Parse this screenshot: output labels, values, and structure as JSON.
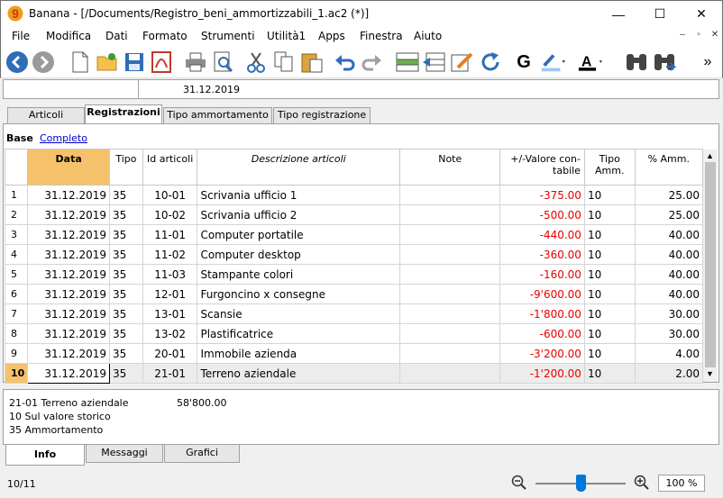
{
  "window": {
    "title": "Banana - [/Documents/Registro_beni_ammortizzabili_1.ac2 (*)]",
    "minimize": "—",
    "maximize": "☐",
    "close": "✕"
  },
  "menu": [
    "File",
    "Modifica",
    "Dati",
    "Formato",
    "Strumenti",
    "Utilità1",
    "Apps",
    "Finestra",
    "Aiuto"
  ],
  "mdi_controls": [
    "–",
    "▫",
    "✕"
  ],
  "toolbar": {
    "bold_label": "G",
    "more_label": "»",
    "icons": [
      "back-icon",
      "forward-icon",
      "new-file-icon",
      "open-folder-icon",
      "save-icon",
      "pdf-icon",
      "print-icon",
      "print-preview-icon",
      "cut-icon",
      "copy-icon",
      "paste-icon",
      "undo-icon",
      "redo-icon",
      "insert-row-icon",
      "delete-row-icon",
      "edit-pencil-icon",
      "refresh-icon",
      "bold-icon",
      "highlight-icon",
      "font-color-icon",
      "find-icon",
      "find-next-icon"
    ]
  },
  "cellbar": {
    "value": "31.12.2019"
  },
  "tabs": [
    "Articoli",
    "Registrazioni",
    "Tipo ammortamento",
    "Tipo registrazione"
  ],
  "active_tab": "Registrazioni",
  "views": {
    "base": "Base",
    "completo": "Completo"
  },
  "table": {
    "columns": [
      "Data",
      "Tipo",
      "Id articoli",
      "Descrizione articoli",
      "Note",
      "+/-Valore con-\ntabile",
      "Tipo\nAmm.",
      "% Amm."
    ],
    "rows": [
      {
        "n": "1",
        "data": "31.12.2019",
        "tipo": "35",
        "id": "10-01",
        "desc": "Scrivania ufficio 1",
        "note": "",
        "valore": "-375.00",
        "tipo_amm": "10",
        "perc": "25.00"
      },
      {
        "n": "2",
        "data": "31.12.2019",
        "tipo": "35",
        "id": "10-02",
        "desc": "Scrivania ufficio 2",
        "note": "",
        "valore": "-500.00",
        "tipo_amm": "10",
        "perc": "25.00"
      },
      {
        "n": "3",
        "data": "31.12.2019",
        "tipo": "35",
        "id": "11-01",
        "desc": "Computer portatile",
        "note": "",
        "valore": "-440.00",
        "tipo_amm": "10",
        "perc": "40.00"
      },
      {
        "n": "4",
        "data": "31.12.2019",
        "tipo": "35",
        "id": "11-02",
        "desc": "Computer desktop",
        "note": "",
        "valore": "-360.00",
        "tipo_amm": "10",
        "perc": "40.00"
      },
      {
        "n": "5",
        "data": "31.12.2019",
        "tipo": "35",
        "id": "11-03",
        "desc": "Stampante colori",
        "note": "",
        "valore": "-160.00",
        "tipo_amm": "10",
        "perc": "40.00"
      },
      {
        "n": "6",
        "data": "31.12.2019",
        "tipo": "35",
        "id": "12-01",
        "desc": "Furgoncino x consegne",
        "note": "",
        "valore": "-9'600.00",
        "tipo_amm": "10",
        "perc": "40.00"
      },
      {
        "n": "7",
        "data": "31.12.2019",
        "tipo": "35",
        "id": "13-01",
        "desc": "Scansie",
        "note": "",
        "valore": "-1'800.00",
        "tipo_amm": "10",
        "perc": "30.00"
      },
      {
        "n": "8",
        "data": "31.12.2019",
        "tipo": "35",
        "id": "13-02",
        "desc": "Plastificatrice",
        "note": "",
        "valore": "-600.00",
        "tipo_amm": "10",
        "perc": "30.00"
      },
      {
        "n": "9",
        "data": "31.12.2019",
        "tipo": "35",
        "id": "20-01",
        "desc": "Immobile azienda",
        "note": "",
        "valore": "-3'200.00",
        "tipo_amm": "10",
        "perc": "4.00"
      },
      {
        "n": "10",
        "data": "31.12.2019",
        "tipo": "35",
        "id": "21-01",
        "desc": "Terreno aziendale",
        "note": "",
        "valore": "-1'200.00",
        "tipo_amm": "10",
        "perc": "2.00"
      }
    ]
  },
  "info": {
    "line1_label": "21-01 Terreno aziendale",
    "line1_value": "58'800.00",
    "line2": "10 Sul valore storico",
    "line3": "35 Ammortamento"
  },
  "bottom_tabs": [
    "Info",
    "Messaggi",
    "Grafici"
  ],
  "status": {
    "position": "10/11",
    "zoom": "100 %",
    "zoom_level_percent": 100
  },
  "colors": {
    "accent_header": "#f5c26b",
    "negative_value": "#e60000",
    "link": "#0000cc",
    "zoom_thumb": "#0078d7"
  }
}
